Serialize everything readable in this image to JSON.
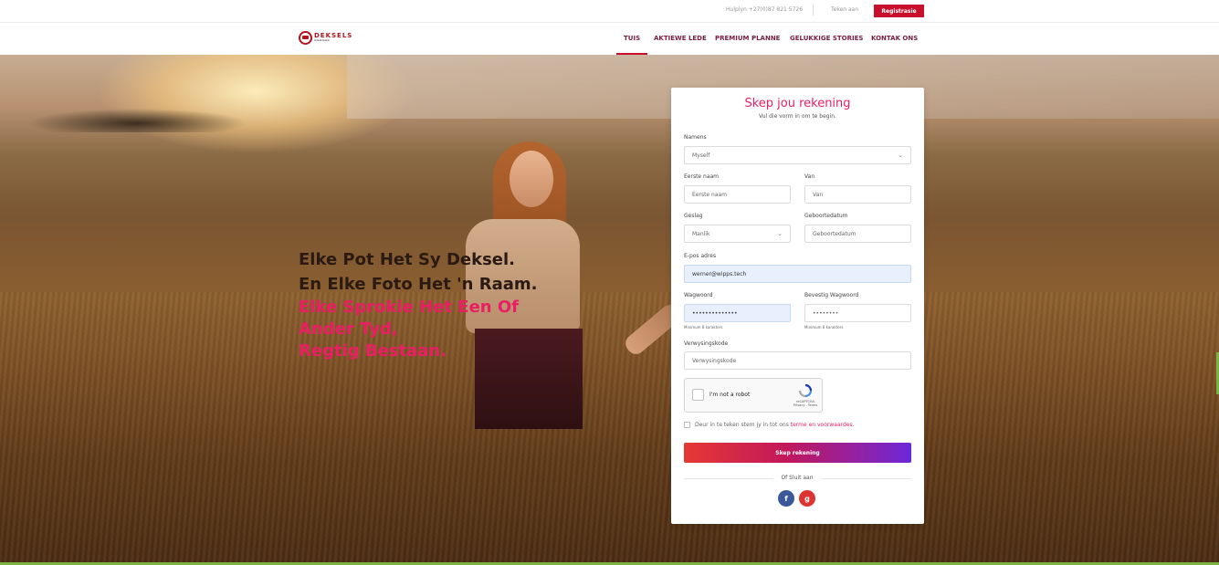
{
  "topbar": {
    "help": "Hulplyn +27(0)87 821 5726",
    "login": "Teken aan",
    "register": "Registrasie",
    "register_color": "#c8102e"
  },
  "logo": {
    "word": "DEKSELS"
  },
  "nav": {
    "items": [
      {
        "label": "TUIS",
        "active": true
      },
      {
        "label": "AKTIEWE LEDE"
      },
      {
        "label": "PREMIUM PLANNE"
      },
      {
        "label": "GELUKKIGE STORIES"
      },
      {
        "label": "KONTAK ONS"
      }
    ],
    "link_color": "#7a2045",
    "active_underline_color": "#c8102e"
  },
  "hero": {
    "lines": [
      "Elke Pot Het Sy Deksel.",
      "En Elke Foto Het 'n Raam.",
      "Elke Sprokie Het Een Of",
      "Ander Tyd,",
      "Regtig Bestaan."
    ],
    "accent_color": "#e91e63"
  },
  "form": {
    "title": "Skep jou rekening",
    "subtitle": "Vul die vorm in om te begin.",
    "names_label": "Namens",
    "names_value": "Myself",
    "first_name_label": "Eerste naam",
    "first_name_placeholder": "Eerste naam",
    "surname_label": "Van",
    "surname_placeholder": "Van",
    "gender_label": "Geslag",
    "gender_value": "Manlik",
    "dob_label": "Geboortedatum",
    "dob_placeholder": "Geboortedatum",
    "email_label": "E-pos adres",
    "email_value": "werner@wipps.tech",
    "password_label": "Wagwoord",
    "password_value": "••••••••••••••",
    "password_hint": "Minimum 8 karakters",
    "confirm_label": "Bevestig Wagwoord",
    "confirm_placeholder": "••••••••",
    "confirm_hint": "Minimum 8 karakters",
    "referral_label": "Verwysingskode",
    "referral_placeholder": "Verwysingskode",
    "captcha_text": "I'm not a robot",
    "captcha_brand": "reCAPTCHA",
    "captcha_links": "Privacy - Terms",
    "terms_text": "Deur in te teken stem jy in tot ons ",
    "terms_link": "terme en voorwaardes.",
    "submit": "Skep rekening",
    "or_text": "Of Sluit aan",
    "facebook": "f",
    "google": "g"
  }
}
